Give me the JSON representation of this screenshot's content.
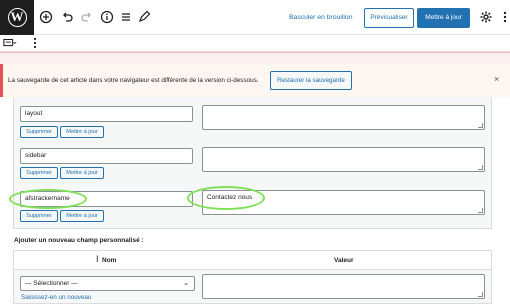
{
  "topbar": {
    "toolbar_icons": [
      "wordpress-logo",
      "add-block-icon",
      "undo-icon",
      "redo-icon",
      "details-icon",
      "list-view-icon",
      "edit-tools-icon"
    ],
    "switch_to_draft": "Basculer en brouillon",
    "preview": "Prévisualiser",
    "update": "Mettre à jour",
    "settings_icon": "gear-icon",
    "more_icon": "vertical-ellipsis-icon"
  },
  "toolbar2": {
    "icons": [
      "block-layout-icon",
      "vertical-ellipsis-icon"
    ]
  },
  "notice": {
    "message": "La sauvegarde de cet article dans votre navigateur est différente de la version ci-dessous.",
    "restore_button": "Restaurer la sauvegarde",
    "close": "×"
  },
  "custom_fields": {
    "rows": [
      {
        "name": "layout",
        "value": "",
        "delete": "Supprimer",
        "update": "Mettre à jour"
      },
      {
        "name": "sidebar",
        "value": "",
        "delete": "Supprimer",
        "update": "Mettre à jour"
      },
      {
        "name": "afstrackername",
        "value": "Contactez nous",
        "delete": "Supprimer",
        "update": "Mettre à jour"
      }
    ],
    "add_title": "Ajouter un nouveau champ personnalisé :",
    "col_name": "Nom",
    "col_value": "Valeur",
    "select_value": "— Sélectionner —",
    "enter_new": "Saisissez-en un nouveau"
  },
  "colors": {
    "accent": "#2271b1",
    "highlight": "#7fe058"
  }
}
